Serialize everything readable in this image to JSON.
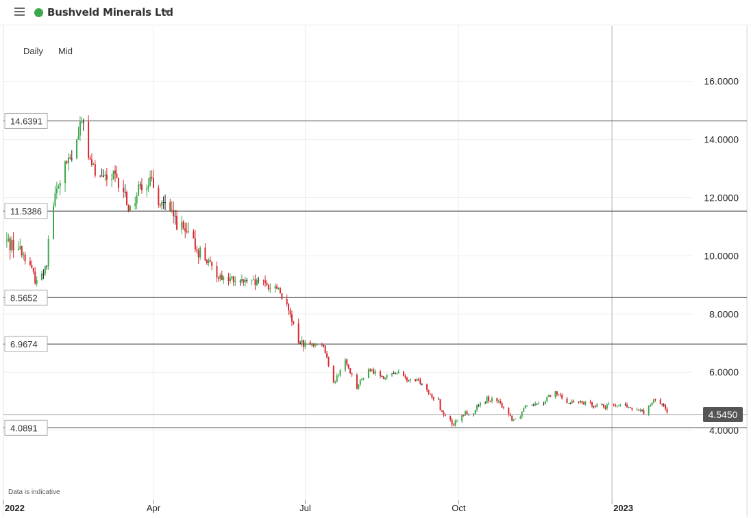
{
  "header": {
    "instrument_name": "Bushveld Minerals Ltd",
    "status_color": "#3aa84a"
  },
  "chart_controls": {
    "interval": "Daily",
    "price_type": "Mid"
  },
  "footer": {
    "note": "Data is indicative"
  },
  "chart_data": {
    "type": "candlestick",
    "title": "",
    "xlabel": "",
    "ylabel": "",
    "x_range": [
      "2022-01-01",
      "2023-02-18"
    ],
    "ylim": [
      1.6,
      17.9
    ],
    "y_ticks": [
      "16.0000",
      "14.0000",
      "12.0000",
      "10.0000",
      "8.0000",
      "6.0000",
      "4.0000"
    ],
    "x_ticks": [
      {
        "date": "2022-01-01",
        "label": "2022",
        "bold": true
      },
      {
        "date": "2022-04-01",
        "label": "Apr",
        "bold": false
      },
      {
        "date": "2022-07-01",
        "label": "Jul",
        "bold": false
      },
      {
        "date": "2022-10-01",
        "label": "Oct",
        "bold": false
      },
      {
        "date": "2023-01-01",
        "label": "2023",
        "bold": true
      }
    ],
    "grid": true,
    "colors": {
      "up": "#3aa84a",
      "down": "#d8262e",
      "flat": "#222222",
      "last_price": "#555555"
    },
    "horizontal_levels": [
      "14.6391",
      "11.5386",
      "8.5652",
      "6.9674",
      "4.0891"
    ],
    "last_price": "4.5450",
    "anchors": [
      [
        "2022-01-01",
        10.5
      ],
      [
        "2022-01-08",
        10.4
      ],
      [
        "2022-01-15",
        9.9
      ],
      [
        "2022-01-20",
        9.2
      ],
      [
        "2022-01-25",
        9.3
      ],
      [
        "2022-01-31",
        11.8
      ],
      [
        "2022-02-06",
        13.0
      ],
      [
        "2022-02-12",
        13.4
      ],
      [
        "2022-02-17",
        14.6
      ],
      [
        "2022-02-21",
        13.3
      ],
      [
        "2022-02-28",
        12.6
      ],
      [
        "2022-03-08",
        12.7
      ],
      [
        "2022-03-14",
        12.1
      ],
      [
        "2022-03-18",
        11.6
      ],
      [
        "2022-03-24",
        12.4
      ],
      [
        "2022-03-29",
        12.6
      ],
      [
        "2022-04-08",
        11.6
      ],
      [
        "2022-04-16",
        11.1
      ],
      [
        "2022-04-22",
        10.6
      ],
      [
        "2022-05-01",
        10.0
      ],
      [
        "2022-05-08",
        9.4
      ],
      [
        "2022-05-15",
        9.2
      ],
      [
        "2022-05-25",
        9.1
      ],
      [
        "2022-06-05",
        9.0
      ],
      [
        "2022-06-15",
        8.9
      ],
      [
        "2022-06-20",
        8.2
      ],
      [
        "2022-06-27",
        7.1
      ],
      [
        "2022-07-05",
        6.9
      ],
      [
        "2022-07-12",
        6.9
      ],
      [
        "2022-07-18",
        5.6
      ],
      [
        "2022-07-25",
        6.4
      ],
      [
        "2022-08-01",
        5.5
      ],
      [
        "2022-08-08",
        6.1
      ],
      [
        "2022-08-18",
        5.8
      ],
      [
        "2022-08-25",
        6.0
      ],
      [
        "2022-09-01",
        5.7
      ],
      [
        "2022-09-07",
        5.7
      ],
      [
        "2022-09-15",
        5.2
      ],
      [
        "2022-09-20",
        4.7
      ],
      [
        "2022-09-28",
        4.2
      ],
      [
        "2022-10-05",
        4.6
      ],
      [
        "2022-10-12",
        4.8
      ],
      [
        "2022-10-18",
        5.1
      ],
      [
        "2022-10-24",
        5.0
      ],
      [
        "2022-10-28",
        4.8
      ],
      [
        "2022-11-02",
        4.4
      ],
      [
        "2022-11-06",
        4.4
      ],
      [
        "2022-11-10",
        4.9
      ],
      [
        "2022-11-20",
        5.0
      ],
      [
        "2022-11-28",
        5.3
      ],
      [
        "2022-12-05",
        5.0
      ],
      [
        "2022-12-20",
        4.9
      ],
      [
        "2022-12-28",
        4.8
      ],
      [
        "2023-01-02",
        4.9
      ],
      [
        "2023-01-10",
        4.8
      ],
      [
        "2023-01-20",
        4.6
      ],
      [
        "2023-01-26",
        5.1
      ],
      [
        "2023-01-31",
        4.9
      ],
      [
        "2023-02-03",
        4.55
      ]
    ]
  }
}
